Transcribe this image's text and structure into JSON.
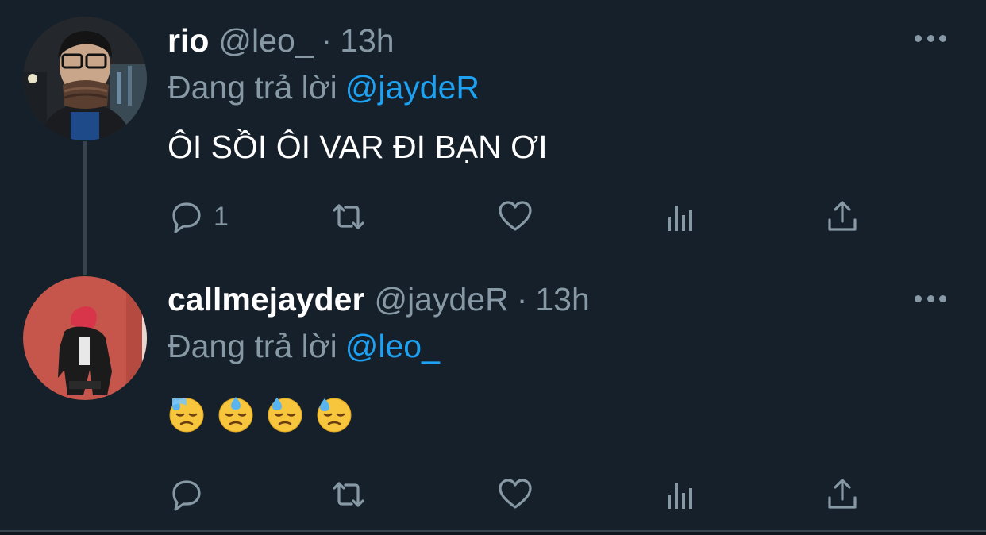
{
  "tweets": [
    {
      "display_name": "rio",
      "handle": "@leo_",
      "separator": "·",
      "time": "13h",
      "reply_prefix": "Đang trả lời",
      "reply_to": "@jaydeR",
      "text": "ÔI SỒI ÔI VAR ĐI BẠN ƠI",
      "reply_count": "1",
      "avatar_colors": {
        "bg": "#2a2f35",
        "accent": "#6b4b3a"
      }
    },
    {
      "display_name": "callmejayder",
      "handle": "@jaydeR",
      "separator": "·",
      "time": "13h",
      "reply_prefix": "Đang trả lời",
      "reply_to": "@leo_",
      "emojis": [
        "downcast-face-with-sweat",
        "downcast-face-with-sweat",
        "downcast-face-with-sweat",
        "downcast-face-with-sweat"
      ],
      "reply_count": "",
      "avatar_colors": {
        "bg": "#c9554a",
        "accent": "#1a1a1a"
      }
    }
  ],
  "colors": {
    "background": "#15202b",
    "muted": "#8899a6",
    "link": "#1da1f2",
    "thread_line": "#38444d"
  }
}
